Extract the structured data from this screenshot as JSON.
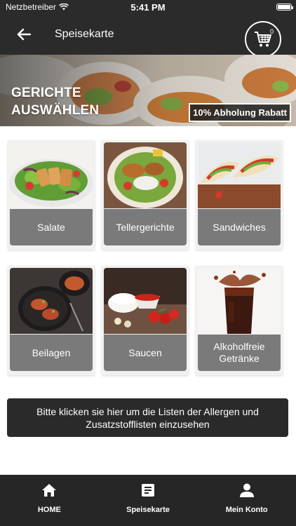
{
  "status_bar": {
    "carrier": "Netzbetreiber",
    "time": "5:41 PM"
  },
  "nav": {
    "title": "Speisekarte",
    "cart_count": "0"
  },
  "hero": {
    "title": "GERICHTE\nAUSWÄHLEN",
    "badge": "10% Abholung Rabatt"
  },
  "categories": [
    {
      "label": "Salate"
    },
    {
      "label": "Tellergerichte"
    },
    {
      "label": "Sandwiches"
    },
    {
      "label": "Beilagen"
    },
    {
      "label": "Saucen"
    },
    {
      "label": "Alkoholfreie\nGetränke"
    }
  ],
  "allergen_button": {
    "label": "Bitte klicken sie hier um die Listen der Allergen und Zusatzstofflisten einzusehen"
  },
  "tabs": [
    {
      "label": "HOME",
      "icon": "home-icon"
    },
    {
      "label": "Speisekarte",
      "icon": "menu-list-icon"
    },
    {
      "label": "Mein Konto",
      "icon": "user-icon"
    }
  ],
  "colors": {
    "header": "#2b2b2b",
    "card_label": "#7a7a7a",
    "tab_bar": "#262626"
  }
}
